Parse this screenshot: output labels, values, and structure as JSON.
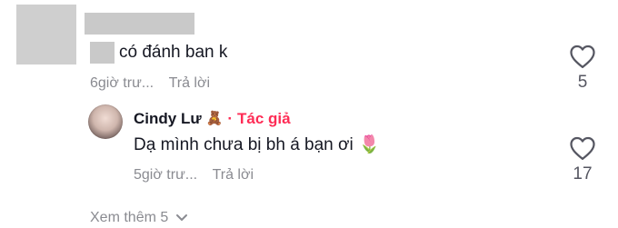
{
  "comment": {
    "text": "có đánh ban k",
    "time": "6giờ trư...",
    "reply_label": "Trả lời",
    "likes": "5"
  },
  "reply": {
    "author": "Cindy Lư",
    "author_emoji": "🧸",
    "separator": "·",
    "badge": "Tác giả",
    "text": "Dạ mình chưa bị bh á bạn ơi",
    "text_emoji": "🌷",
    "time": "5giờ trư...",
    "reply_label": "Trả lời",
    "likes": "17"
  },
  "view_more": {
    "label": "Xem thêm 5"
  },
  "colors": {
    "accent": "#fe2c55",
    "muted": "#8a8b91",
    "text": "#161823",
    "redaction": "#c9c9c9"
  }
}
